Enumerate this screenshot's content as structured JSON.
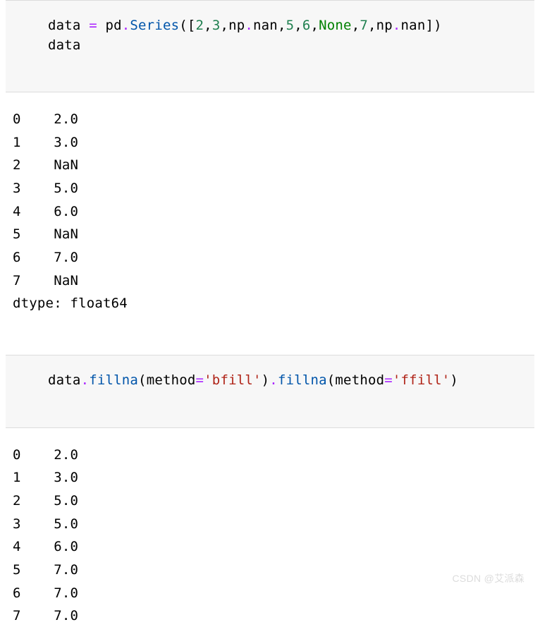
{
  "cells": [
    {
      "code_tokens": [
        [
          [
            "data",
            "name"
          ],
          [
            " ",
            "punc"
          ],
          [
            "=",
            "op"
          ],
          [
            " ",
            "punc"
          ],
          [
            "pd",
            "name"
          ],
          [
            ".",
            "op"
          ],
          [
            "Series",
            "call"
          ],
          [
            "(",
            "punc"
          ],
          [
            "[",
            "punc"
          ],
          [
            "2",
            "num"
          ],
          [
            ",",
            "punc"
          ],
          [
            "3",
            "num"
          ],
          [
            ",",
            "punc"
          ],
          [
            "np",
            "name"
          ],
          [
            ".",
            "op"
          ],
          [
            "nan",
            "name"
          ],
          [
            ",",
            "punc"
          ],
          [
            "5",
            "num"
          ],
          [
            ",",
            "punc"
          ],
          [
            "6",
            "num"
          ],
          [
            ",",
            "punc"
          ],
          [
            "None",
            "kw"
          ],
          [
            ",",
            "punc"
          ],
          [
            "7",
            "num"
          ],
          [
            ",",
            "punc"
          ],
          [
            "np",
            "name"
          ],
          [
            ".",
            "op"
          ],
          [
            "nan",
            "name"
          ],
          [
            "]",
            "punc"
          ],
          [
            ")",
            "punc"
          ]
        ],
        [
          [
            "data",
            "name"
          ]
        ]
      ],
      "output_lines": [
        "0    2.0",
        "1    3.0",
        "2    NaN",
        "3    5.0",
        "4    6.0",
        "5    NaN",
        "6    7.0",
        "7    NaN",
        "dtype: float64"
      ]
    },
    {
      "code_tokens": [
        [
          [
            "data",
            "name"
          ],
          [
            ".",
            "op"
          ],
          [
            "fillna",
            "call"
          ],
          [
            "(",
            "punc"
          ],
          [
            "method",
            "name"
          ],
          [
            "=",
            "op"
          ],
          [
            "'bfill'",
            "str"
          ],
          [
            ")",
            "punc"
          ],
          [
            ".",
            "op"
          ],
          [
            "fillna",
            "call"
          ],
          [
            "(",
            "punc"
          ],
          [
            "method",
            "name"
          ],
          [
            "=",
            "op"
          ],
          [
            "'ffill'",
            "str"
          ],
          [
            ")",
            "punc"
          ]
        ]
      ],
      "output_lines": [
        "0    2.0",
        "1    3.0",
        "2    5.0",
        "3    5.0",
        "4    6.0",
        "5    7.0",
        "6    7.0",
        "7    7.0"
      ]
    }
  ],
  "watermark": "CSDN @艾派森"
}
